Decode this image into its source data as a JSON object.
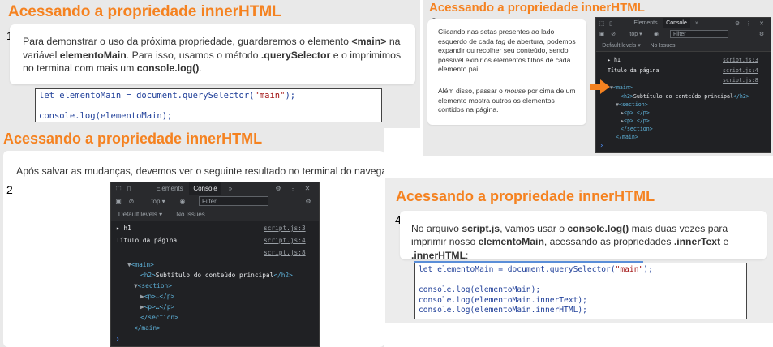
{
  "slide_title": "Acessando a propriedade innerHTML",
  "panel1": {
    "number": "1",
    "text_parts": [
      {
        "t": "Para demonstrar o uso da próxima propriedade, guardaremos o elemento ",
        "b": false
      },
      {
        "t": "<main>",
        "b": true
      },
      {
        "t": " na variável ",
        "b": false
      },
      {
        "t": "elementoMain",
        "b": true
      },
      {
        "t": ". Para isso, usamos o método ",
        "b": false
      },
      {
        "t": ".querySelector",
        "b": true
      },
      {
        "t": " e o imprimimos no terminal com mais um ",
        "b": false
      },
      {
        "t": "console.log()",
        "b": true
      },
      {
        "t": ".",
        "b": false
      }
    ],
    "code": [
      [
        {
          "t": "let elementoMain = document.querySelector(",
          "c": "kw"
        },
        {
          "t": "\"main\"",
          "c": "str"
        },
        {
          "t": ");",
          "c": "kw"
        }
      ],
      [],
      [
        {
          "t": "console.log(elementoMain);",
          "c": "kw"
        }
      ]
    ]
  },
  "panel2": {
    "number": "2",
    "text": "Após salvar as mudanças, devemos ver o seguinte resultado no terminal do navegador:"
  },
  "panel3": {
    "number": "3",
    "para1_parts": [
      {
        "t": "Clicando nas setas presentes ao lado esquerdo de cada ",
        "i": false
      },
      {
        "t": "tag",
        "i": true
      },
      {
        "t": " de abertura, podemos expandir ou recolher seu conteúdo, sendo possível exibir os elementos filhos de cada elemento pai.",
        "i": false
      }
    ],
    "para2_parts": [
      {
        "t": "Além disso, passar o ",
        "i": false
      },
      {
        "t": "mouse",
        "i": true
      },
      {
        "t": " por cima de um elemento mostra outros os elementos contidos na página.",
        "i": false
      }
    ]
  },
  "panel4": {
    "number": "4",
    "text_parts": [
      {
        "t": "No arquivo ",
        "b": false
      },
      {
        "t": "script.js",
        "b": true
      },
      {
        "t": ", vamos usar o ",
        "b": false
      },
      {
        "t": "console.log()",
        "b": true
      },
      {
        "t": " mais duas vezes para imprimir nosso ",
        "b": false
      },
      {
        "t": "elementoMain",
        "b": true
      },
      {
        "t": ", acessando as propriedades ",
        "b": false
      },
      {
        "t": ".innerText",
        "b": true
      },
      {
        "t": " e ",
        "b": false
      },
      {
        "t": ".innerHTML",
        "b": true
      },
      {
        "t": ":",
        "b": false
      }
    ],
    "code": [
      [
        {
          "t": "let elementoMain = document.querySelector(",
          "c": "kw"
        },
        {
          "t": "\"main\"",
          "c": "str"
        },
        {
          "t": ");",
          "c": "kw"
        }
      ],
      [],
      [
        {
          "t": "console.log(elementoMain);",
          "c": "kw"
        }
      ],
      [
        {
          "t": "console.log(elementoMain.innerText);",
          "c": "kw"
        }
      ],
      [
        {
          "t": "console.log(elementoMain.innerHTML);",
          "c": "kw"
        }
      ]
    ]
  },
  "devtools": {
    "tab_elements": "Elements",
    "tab_console": "Console",
    "more_tabs": "»",
    "context": "top ▾",
    "filter_placeholder": "Filter",
    "default_levels": "Default levels ▾",
    "no_issues": "No Issues",
    "log_h1": "▸ h1",
    "log_title": "Título da página",
    "link1": "script.js:3",
    "link2": "script.js:4",
    "link3": "script.js:8",
    "main_open": "<main>",
    "h2_open": "<h2>",
    "h2_text": "Subtítulo do conteúdo principal",
    "h2_close": "</h2>",
    "section_open": "<section>",
    "p1": "<p>…</p>",
    "p2": "<p>…</p>",
    "section_close": "</section>",
    "main_close": "</main>",
    "prompt": "›",
    "icon_color": "#9aa0a6",
    "accent": "#f58220"
  }
}
